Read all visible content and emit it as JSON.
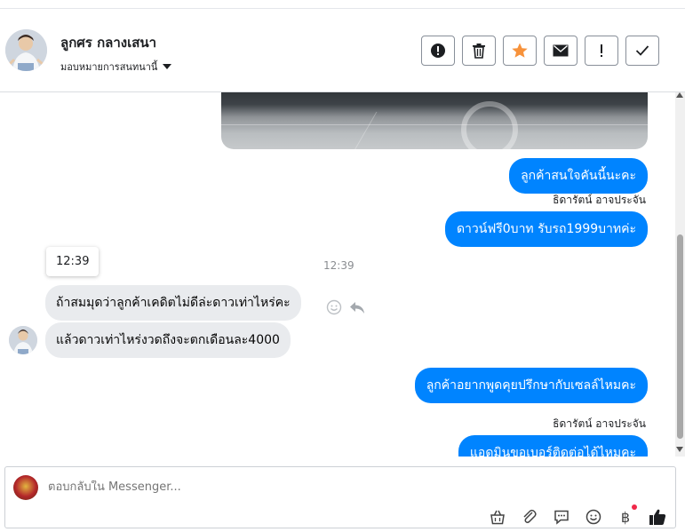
{
  "header": {
    "contact_name": "ลูกศร กลางเสนา",
    "assign_label": "มอบหมายการสนทนานี้",
    "actions": [
      {
        "name": "alert-circle-button",
        "icon": "exclamation-circle-icon"
      },
      {
        "name": "delete-button",
        "icon": "trash-icon"
      },
      {
        "name": "star-button",
        "icon": "star-icon"
      },
      {
        "name": "mark-unread-button",
        "icon": "envelope-icon"
      },
      {
        "name": "follow-up-button",
        "icon": "exclamation-icon"
      },
      {
        "name": "done-button",
        "icon": "check-icon"
      }
    ]
  },
  "messages": {
    "out1": "ลูกค้าสนใจคันนี้นะคะ",
    "sender1": "ธิดารัตน์ อาจประจัน",
    "out2": "ดาวน์ฟรี0บาท รับรถ1999บาทค่ะ",
    "tooltip_time": "12:39",
    "center_time": "12:39",
    "in1": "ถ้าสมมุดว่าลูกค้าเคดิตไม่ดีล่ะดาวเท่าไหร่คะ",
    "in2": "แล้วดาวเท่าไหร่งวดถึงจะตกเดือนละ4000",
    "out3": "ลูกค้าอยากพูดคุยปรึกษากับเซลล์ไหมคะ",
    "sender2": "ธิดารัตน์ อาจประจัน",
    "out4": "แอดมินขอเบอร์ติดต่อได้ไหมคะ"
  },
  "composer": {
    "placeholder": "ตอบกลับใน Messenger..."
  },
  "colors": {
    "accent": "#0084ff",
    "star": "#f7923b",
    "incoming_bg": "#e9ebee",
    "notification_dot": "#f02849"
  }
}
